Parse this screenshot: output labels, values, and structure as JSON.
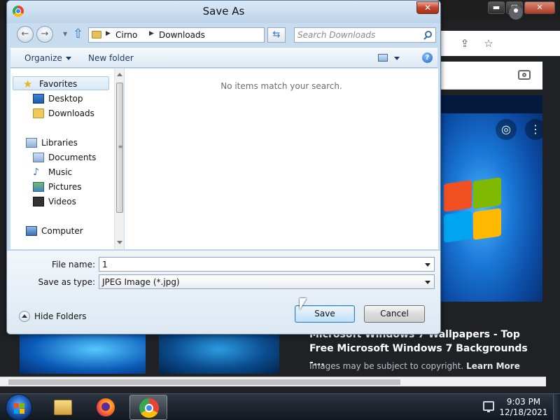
{
  "dialog": {
    "title": "Save As",
    "close_glyph": "✕",
    "address": {
      "breadcrumb": [
        "Cirno",
        "Downloads"
      ]
    },
    "search": {
      "placeholder": "Search Downloads"
    },
    "toolbar": {
      "organize": "Organize",
      "new_folder": "New folder"
    },
    "nav": {
      "favorites": {
        "label": "Favorites",
        "items": [
          "Desktop",
          "Downloads"
        ]
      },
      "libraries": {
        "label": "Libraries",
        "items": [
          "Documents",
          "Music",
          "Pictures",
          "Videos"
        ]
      },
      "computer": "Computer"
    },
    "empty_message": "No items match your search.",
    "file_name": {
      "label": "File name:",
      "value": "1"
    },
    "save_as_type": {
      "label": "Save as type:",
      "value": "JPEG Image (*.jpg)"
    },
    "hide_folders": "Hide Folders",
    "save_button": "Save",
    "cancel_button": "Cancel"
  },
  "browser": {
    "result_title": "Microsoft Windows 7 Wallpapers - Top Free Microsoft Windows 7 Backgrounds -...",
    "result_note": "Images may be subject to copyright.",
    "learn_more": "Learn More"
  },
  "window_controls": {
    "minimize": "▬",
    "maximize": "▢",
    "close": "✕"
  },
  "taskbar": {
    "apps": [
      "windows-explorer",
      "firefox",
      "chrome"
    ],
    "clock_time": "9:03 PM",
    "clock_date": "12/18/2021"
  },
  "icons": {
    "back": "back-arrow-icon",
    "forward": "forward-arrow-icon",
    "up": "up-arrow-icon",
    "refresh": "refresh-icon",
    "search": "search-icon",
    "help": "help-icon",
    "favorites": "star-icon",
    "folder": "folder-icon",
    "libraries": "library-icon",
    "music": "music-icon",
    "pictures": "pictures-icon",
    "videos": "videos-icon",
    "computer": "computer-icon"
  },
  "colors": {
    "dialog_frame": "#c8dcf0",
    "primary_button": "#bfe0f8",
    "close_button": "#c4442a",
    "taskbar": "#131820"
  }
}
